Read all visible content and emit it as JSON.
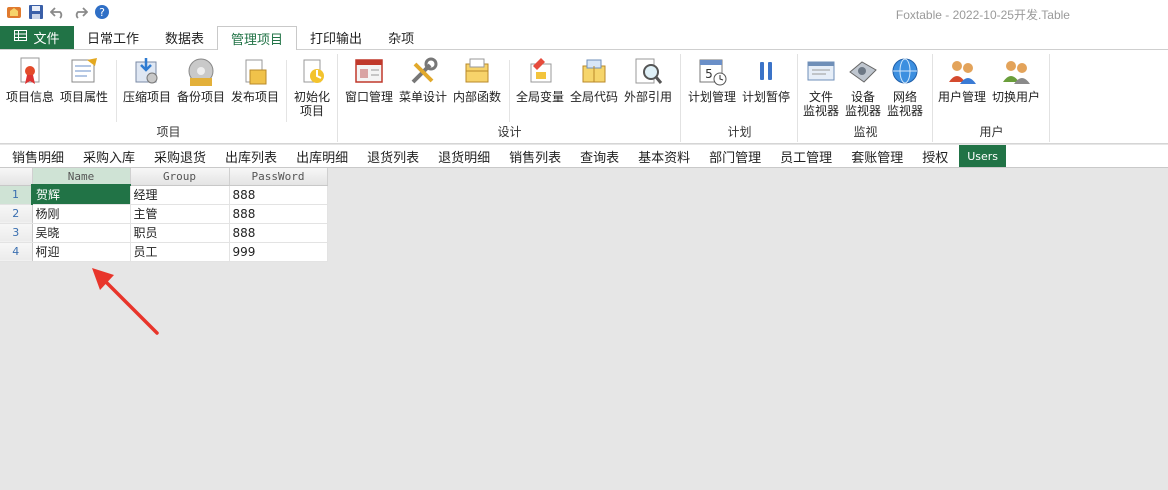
{
  "app_title": "Foxtable - 2022-10-25开发.Table",
  "qat": [
    "app-icon",
    "save-icon",
    "undo-icon",
    "redo-icon",
    "help-icon"
  ],
  "ribbon_tabs": [
    "文件",
    "日常工作",
    "数据表",
    "管理项目",
    "打印输出",
    "杂项"
  ],
  "active_tab": "管理项目",
  "groups": {
    "project": {
      "label": "项目",
      "buttons": [
        "项目信息",
        "项目属性",
        "压缩项目",
        "备份项目",
        "发布项目",
        "初始化",
        "项目"
      ]
    },
    "design": {
      "label": "设计",
      "buttons": [
        "窗口管理",
        "菜单设计",
        "内部函数",
        "全局变量",
        "全局代码",
        "外部引用"
      ]
    },
    "plan": {
      "label": "计划",
      "buttons": [
        "计划管理",
        "计划暂停"
      ]
    },
    "monitor": {
      "label": "监视",
      "buttons": [
        "文件",
        "监视器",
        "设备",
        "监视器",
        "网络",
        "监视器"
      ]
    },
    "user": {
      "label": "用户",
      "buttons": [
        "用户管理",
        "切换用户"
      ]
    }
  },
  "sheet_tabs": [
    "销售明细",
    "采购入库",
    "采购退货",
    "出库列表",
    "出库明细",
    "退货列表",
    "退货明细",
    "销售列表",
    "查询表",
    "基本资料",
    "部门管理",
    "员工管理",
    "套账管理",
    "授权",
    "Users"
  ],
  "active_sheet": "Users",
  "table": {
    "columns": [
      "Name",
      "Group",
      "PassWord"
    ],
    "rows": [
      {
        "num": "1",
        "name": "贺辉",
        "group": "经理",
        "password": "888"
      },
      {
        "num": "2",
        "name": "杨刚",
        "group": "主管",
        "password": "888"
      },
      {
        "num": "3",
        "name": "吴晓",
        "group": "职员",
        "password": "888"
      },
      {
        "num": "4",
        "name": "柯迎",
        "group": "员工",
        "password": "999"
      }
    ]
  },
  "colors": {
    "accent": "#217346",
    "arrow": "#e8352b"
  }
}
